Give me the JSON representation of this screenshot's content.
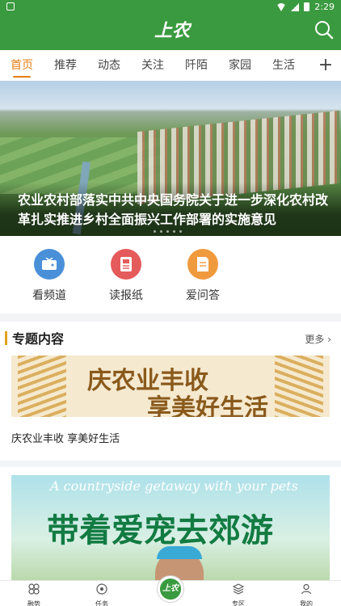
{
  "status_bar": {
    "time": "2:29"
  },
  "header": {
    "logo_text": "上农",
    "accent": "#3a9a3f"
  },
  "tabs": [
    {
      "label": "首页"
    },
    {
      "label": "推荐"
    },
    {
      "label": "动态"
    },
    {
      "label": "关注"
    },
    {
      "label": "阡陌"
    },
    {
      "label": "家园"
    },
    {
      "label": "生活"
    }
  ],
  "tab_add": "+",
  "hero": {
    "caption": "农业农村部落实中共中央国务院关于进一步深化农村改革扎实推进乡村全面振兴工作部署的实施意见"
  },
  "quick": [
    {
      "label": "看频道",
      "icon": "tv-icon",
      "color": "#4a90d9"
    },
    {
      "label": "读报纸",
      "icon": "newspaper-icon",
      "color": "#e55a5a"
    },
    {
      "label": "爱问答",
      "icon": "qa-icon",
      "color": "#f09a3e"
    }
  ],
  "topics": {
    "title": "专题内容",
    "more": "更多",
    "banner_line1": "庆农业丰收",
    "banner_line2": "享美好生活",
    "caption": "庆农业丰收 享美好生活"
  },
  "feature": {
    "subtitle": "A countryside getaway with your pets",
    "title": "带着爱宠去郊游"
  },
  "bottom_nav": [
    {
      "label": "融势",
      "icon": "grid-icon"
    },
    {
      "label": "任务",
      "icon": "target-icon"
    },
    {
      "label": "上农",
      "icon": "logo-icon"
    },
    {
      "label": "专区",
      "icon": "layers-icon"
    },
    {
      "label": "我的",
      "icon": "user-icon"
    }
  ]
}
